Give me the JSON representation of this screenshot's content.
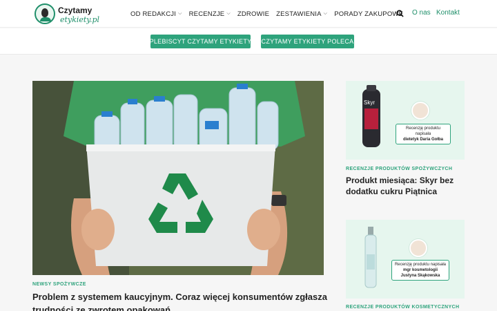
{
  "logo": {
    "title": "Czytamy",
    "subtitle": "etykiety.pl"
  },
  "nav": {
    "items": [
      {
        "label": "OD REDAKCJI",
        "has_menu": true
      },
      {
        "label": "RECENZJE",
        "has_menu": true
      },
      {
        "label": "ZDROWIE",
        "has_menu": false
      },
      {
        "label": "ZESTAWIENIA",
        "has_menu": true
      },
      {
        "label": "PORADY ZAKUPOWE",
        "has_menu": false
      }
    ],
    "chevron": "⌵",
    "about": "O nas",
    "contact": "Kontakt"
  },
  "buttons": {
    "plebiscyt": "PLEBISCYT CZYTAMY ETYKIETY",
    "poleca": "CZYTAMY ETYKIETY POLECA"
  },
  "feature": {
    "category": "NEWSY SPOŻYWCZE",
    "headline_line1": "Problem z systemem kaucyjnym. Coraz więcej konsumentów zgłasza",
    "headline_line2": "trudności ze zwrotem opakowań"
  },
  "side": [
    {
      "category": "RECENZJE PRODUKTÓW SPOŻYWCZYCH",
      "headline_line1": "Produkt miesiąca: Skyr bez",
      "headline_line2": "dodatku cukru Piątnica",
      "product_brand": "Skyr",
      "badge_line1": "Recenzję produktu napisała",
      "badge_line2": "dietetyk Daria Gołba"
    },
    {
      "category": "RECENZJE PRODUKTÓW KOSMETYCZNYCH",
      "badge_line1": "Recenzję produktu napisała",
      "badge_line2": "mgr kosmetologii",
      "badge_line3": "Justyna Skąkowska"
    }
  ],
  "colors": {
    "accent": "#2ea37c",
    "logo_green": "#1f8f6a",
    "card_bg": "#e6f6ee"
  },
  "icons": [
    "search-icon",
    "chevron-down-icon",
    "recycle-icon"
  ]
}
